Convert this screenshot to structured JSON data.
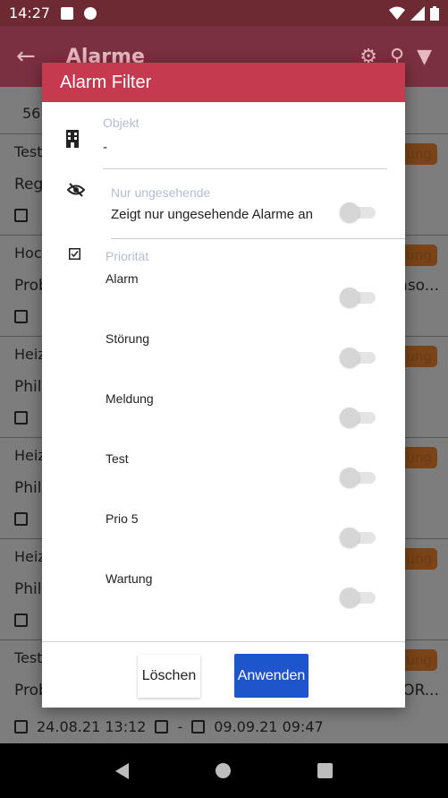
{
  "statusbar": {
    "time": "14:27"
  },
  "appbar": {
    "title": "Alarme"
  },
  "background": {
    "count": "56",
    "rows": [
      {
        "title": "Test",
        "sub": "Reg",
        "badge": "ldung",
        "extra": ""
      },
      {
        "title": "Hoc",
        "sub": "Prob",
        "badge": "rung",
        "extra": "nso..."
      },
      {
        "title": "Heiz",
        "sub": "Phil",
        "badge": "rung",
        "extra": ""
      },
      {
        "title": "Heiz",
        "sub": "Phil",
        "badge": "rung",
        "extra": ""
      },
      {
        "title": "Heiz",
        "sub": "Phil",
        "badge": "rung",
        "extra": ""
      },
      {
        "title": "Test",
        "sub": "Prob",
        "badge": "rung",
        "extra": "ROR..."
      }
    ],
    "bottom": {
      "start": "24.08.21 13:12",
      "separator": "-",
      "end": "09.09.21 09:47"
    }
  },
  "dialog": {
    "title": "Alarm Filter",
    "object_label": "Objekt",
    "object_value": "-",
    "unseen_label": "Nur ungesehende",
    "unseen_desc": "Zeigt nur ungesehende Alarme an",
    "unseen_on": false,
    "priority_label": "Priorität",
    "priorities": [
      {
        "label": "Alarm",
        "on": false
      },
      {
        "label": "Störung",
        "on": false
      },
      {
        "label": "Meldung",
        "on": false
      },
      {
        "label": "Test",
        "on": false
      },
      {
        "label": "Prio 5",
        "on": false
      },
      {
        "label": "Wartung",
        "on": false
      }
    ],
    "clear_button": "Löschen",
    "apply_button": "Anwenden"
  },
  "colors": {
    "header": "#c53a4e",
    "apply": "#1e55cc",
    "label": "#b6bbd4"
  }
}
